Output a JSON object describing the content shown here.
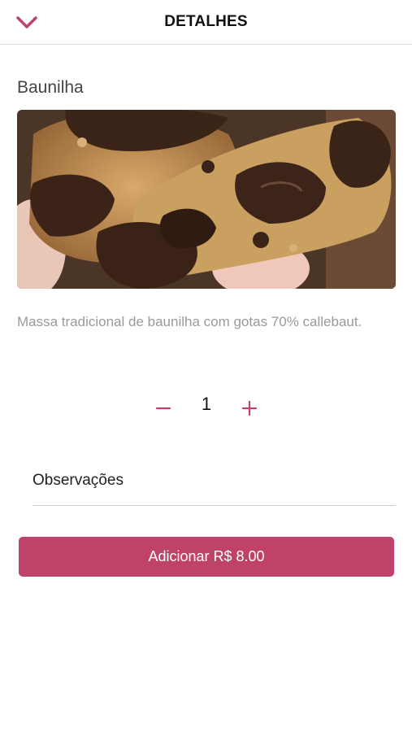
{
  "header": {
    "title": "DETALHES",
    "back_icon": "chevron-down-icon"
  },
  "product": {
    "name": "Baunilha",
    "image_description_icon": "cookie-photo",
    "description": "Massa tradicional de baunilha com gotas 70% callebaut."
  },
  "quantity": {
    "value": "1",
    "minus_icon": "minus-icon",
    "plus_icon": "plus-icon"
  },
  "notes": {
    "label": "Observações"
  },
  "add_button": {
    "label": "Adicionar R$ 8.00"
  },
  "colors": {
    "accent": "#bf4369",
    "text_muted": "#9a9a9a",
    "divider": "#dddddd"
  }
}
